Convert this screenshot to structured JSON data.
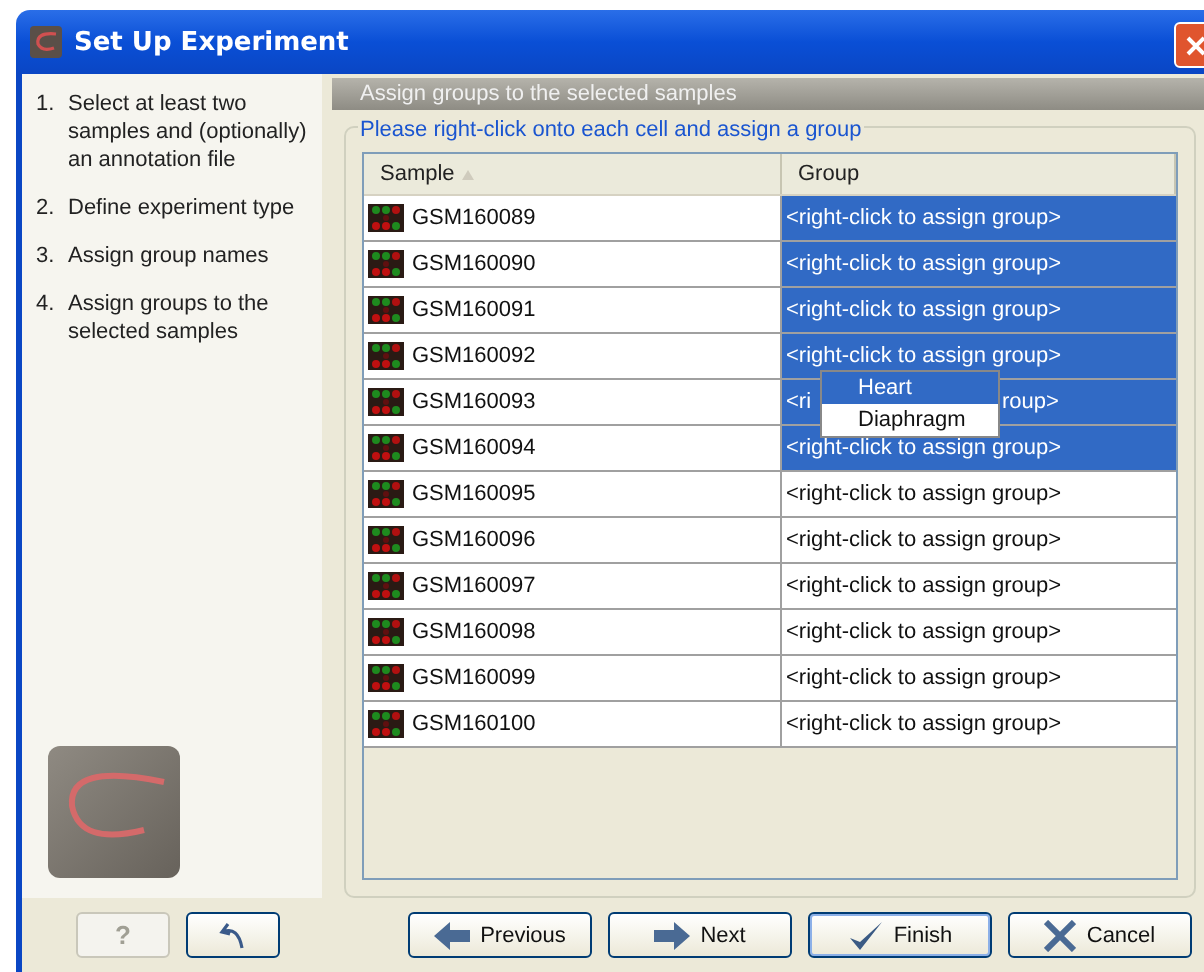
{
  "window": {
    "title": "Set Up Experiment"
  },
  "steps": [
    {
      "number": "1.",
      "text": "Select at least two samples and (optionally) an annotation file"
    },
    {
      "number": "2.",
      "text": "Define experiment type"
    },
    {
      "number": "3.",
      "text": "Assign group names"
    },
    {
      "number": "4.",
      "text": "Assign groups to the selected samples"
    }
  ],
  "panel": {
    "title": "Assign groups to the selected samples",
    "instruction": "Please right-click onto each cell and assign a group"
  },
  "table": {
    "columns": [
      "Sample",
      "Group"
    ],
    "rows": [
      {
        "sample": "GSM160089",
        "group": "<right-click to assign group>",
        "selected": true
      },
      {
        "sample": "GSM160090",
        "group": "<right-click to assign group>",
        "selected": true
      },
      {
        "sample": "GSM160091",
        "group": "<right-click to assign group>",
        "selected": true
      },
      {
        "sample": "GSM160092",
        "group": "<right-click to assign group>",
        "selected": true
      },
      {
        "sample": "GSM160093",
        "group": "<ri",
        "group_tail": "roup>",
        "selected": true
      },
      {
        "sample": "GSM160094",
        "group": "<right-click to assign group>",
        "selected": true
      },
      {
        "sample": "GSM160095",
        "group": "<right-click to assign group>",
        "selected": false
      },
      {
        "sample": "GSM160096",
        "group": "<right-click to assign group>",
        "selected": false
      },
      {
        "sample": "GSM160097",
        "group": "<right-click to assign group>",
        "selected": false
      },
      {
        "sample": "GSM160098",
        "group": "<right-click to assign group>",
        "selected": false
      },
      {
        "sample": "GSM160099",
        "group": "<right-click to assign group>",
        "selected": false
      },
      {
        "sample": "GSM160100",
        "group": "<right-click to assign group>",
        "selected": false
      }
    ]
  },
  "context_menu": {
    "items": [
      {
        "label": "Heart",
        "selected": true
      },
      {
        "label": "Diaphragm",
        "selected": false
      }
    ]
  },
  "buttons": [
    {
      "kind": "help",
      "label": "?",
      "disabled": true
    },
    {
      "kind": "undo",
      "disabled": false
    },
    {
      "kind": "previous",
      "label": "Previous",
      "disabled": false
    },
    {
      "kind": "next",
      "label": "Next",
      "disabled": false
    },
    {
      "kind": "finish",
      "label": "Finish",
      "disabled": false
    },
    {
      "kind": "cancel",
      "label": "Cancel",
      "disabled": false
    }
  ]
}
